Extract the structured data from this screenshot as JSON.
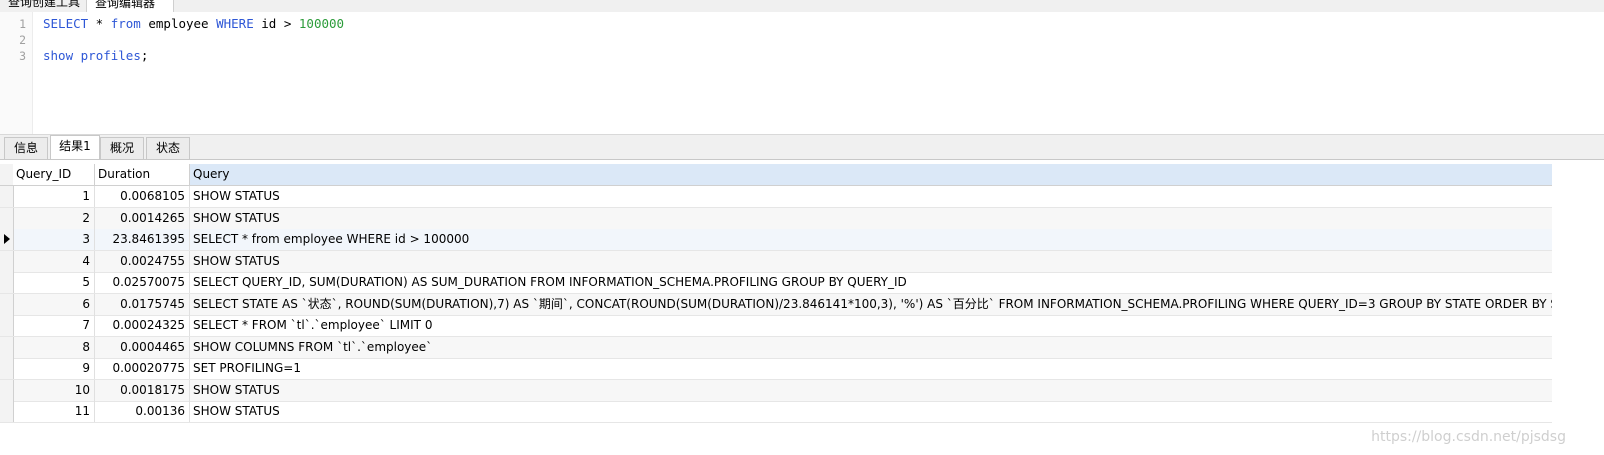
{
  "editor_tabs": [
    "查询创建工具",
    "查询编辑器"
  ],
  "editor": {
    "lines": [
      {
        "n": "1",
        "tokens": [
          {
            "t": "SELECT",
            "c": "kw"
          },
          {
            "t": " * ",
            "c": ""
          },
          {
            "t": "from",
            "c": "kw"
          },
          {
            "t": " employee ",
            "c": ""
          },
          {
            "t": "WHERE",
            "c": "kw"
          },
          {
            "t": " id > ",
            "c": ""
          },
          {
            "t": "100000",
            "c": "num"
          }
        ]
      },
      {
        "n": "2",
        "tokens": []
      },
      {
        "n": "3",
        "tokens": [
          {
            "t": "show",
            "c": "kw"
          },
          {
            "t": " ",
            "c": ""
          },
          {
            "t": "profiles",
            "c": "kw"
          },
          {
            "t": ";",
            "c": ""
          }
        ]
      }
    ]
  },
  "result_tabs": [
    {
      "label": "信息",
      "active": false
    },
    {
      "label": "结果1",
      "active": true
    },
    {
      "label": "概况",
      "active": false
    },
    {
      "label": "状态",
      "active": false
    }
  ],
  "grid": {
    "columns": [
      "Query_ID",
      "Duration",
      "Query"
    ],
    "selected_row": 3,
    "rows": [
      {
        "id": "1",
        "duration": "0.0068105",
        "query": "SHOW STATUS"
      },
      {
        "id": "2",
        "duration": "0.0014265",
        "query": "SHOW STATUS"
      },
      {
        "id": "3",
        "duration": "23.8461395",
        "query": "SELECT * from employee WHERE id > 100000"
      },
      {
        "id": "4",
        "duration": "0.0024755",
        "query": "SHOW STATUS"
      },
      {
        "id": "5",
        "duration": "0.02570075",
        "query": "SELECT QUERY_ID, SUM(DURATION) AS SUM_DURATION FROM INFORMATION_SCHEMA.PROFILING GROUP BY QUERY_ID"
      },
      {
        "id": "6",
        "duration": "0.0175745",
        "query": "SELECT STATE AS `状态`, ROUND(SUM(DURATION),7) AS `期间`, CONCAT(ROUND(SUM(DURATION)/23.846141*100,3), '%') AS `百分比` FROM INFORMATION_SCHEMA.PROFILING WHERE QUERY_ID=3 GROUP BY STATE ORDER BY SEQ"
      },
      {
        "id": "7",
        "duration": "0.00024325",
        "query": "SELECT * FROM `tl`.`employee` LIMIT 0"
      },
      {
        "id": "8",
        "duration": "0.0004465",
        "query": "SHOW COLUMNS FROM `tl`.`employee`"
      },
      {
        "id": "9",
        "duration": "0.00020775",
        "query": "SET PROFILING=1"
      },
      {
        "id": "10",
        "duration": "0.0018175",
        "query": "SHOW STATUS"
      },
      {
        "id": "11",
        "duration": "0.00136",
        "query": "SHOW STATUS"
      }
    ]
  },
  "watermark": "https://blog.csdn.net/pjsdsg"
}
